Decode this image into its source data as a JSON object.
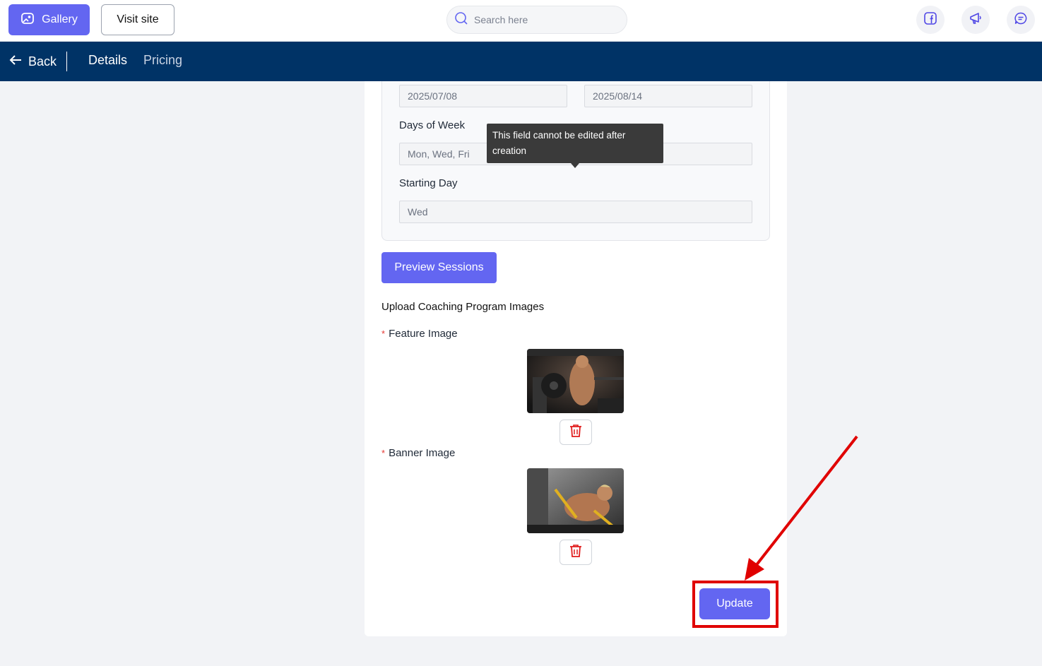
{
  "topbar": {
    "gallery_label": "Gallery",
    "visit_site_label": "Visit site",
    "search_placeholder": "Search here",
    "icons": [
      "facebook-icon",
      "megaphone-icon",
      "chat-icon"
    ],
    "accent_color": "#6366f1"
  },
  "navbar": {
    "back_label": "Back",
    "tabs": [
      {
        "label": "Details",
        "active": true
      },
      {
        "label": "Pricing",
        "active": false
      }
    ],
    "background": "#003366"
  },
  "schedule": {
    "start_date": "2025/07/08",
    "end_date": "2025/08/14",
    "days_of_week_label": "Days of Week",
    "days_of_week_value": "Mon, Wed, Fri",
    "starting_day_label": "Starting Day",
    "starting_day_value": "Wed"
  },
  "tooltip": {
    "text": "This field cannot be edited after creation"
  },
  "preview_button_label": "Preview Sessions",
  "upload": {
    "section_title": "Upload Coaching Program Images",
    "feature_label": "Feature Image",
    "banner_label": "Banner Image",
    "required_mark": "*"
  },
  "update_button_label": "Update",
  "annotation_color": "#e00000"
}
